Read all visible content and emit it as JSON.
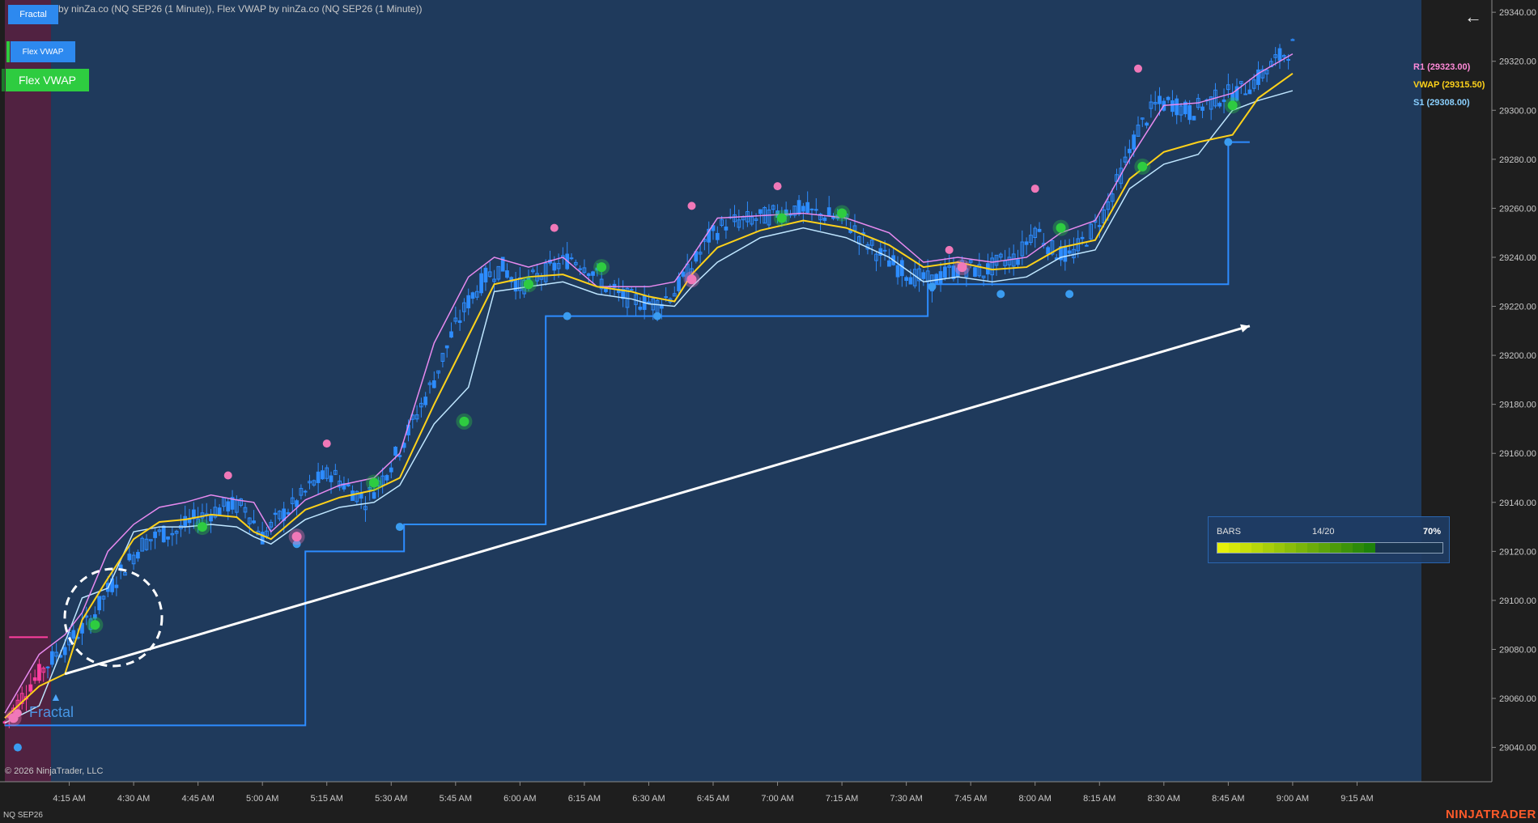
{
  "window": {
    "title": "Fractal Pro by ninZa.co (NQ SEP26 (1 Minute)), Flex VWAP by ninZa.co (NQ SEP26 (1 Minute))",
    "instrument": "NQ SEP26",
    "copyright": "© 2026 NinjaTrader, LLC",
    "brand": "NINJATRADER"
  },
  "buttons": {
    "fractal": "Fractal",
    "flex_vwap_small": "Flex VWAP",
    "flex_vwap_large": "Flex VWAP",
    "back_icon": "arrow-left-icon"
  },
  "watermark": "Fractal",
  "right_labels": {
    "r": "R1 (29323.00)",
    "vwap": "VWAP (29315.50)",
    "s": "S1 (29308.00)"
  },
  "progress_panel": {
    "title": "BARS",
    "count": "14/20",
    "percent": "70%",
    "fraction": 0.7
  },
  "colors": {
    "chart_bg": "#1f3a5c",
    "session_shade": "#5a1e3c",
    "candle": "#2d8cff",
    "upper_band": "#e88af0",
    "vwap": "#ffd21a",
    "lower_band": "#bfe6ff",
    "step_line": "#2d8cff",
    "trend_arrow": "#ffffff",
    "fractal_high": "#f078b8",
    "fractal_low": "#3a9cf0",
    "signal_green": "#2ecc40",
    "signal_pink": "#f078b8"
  },
  "chart_data": {
    "type": "line",
    "y_axis_ticks": [
      29040,
      29060,
      29080,
      29100,
      29120,
      29140,
      29160,
      29180,
      29200,
      29220,
      29240,
      29260,
      29280,
      29300,
      29320,
      29340
    ],
    "y_tick_labels": [
      "29040.00",
      "29060.00",
      "29080.00",
      "29100.00",
      "29120.00",
      "29140.00",
      "29160.00",
      "29180.00",
      "29200.00",
      "29220.00",
      "29240.00",
      "29260.00",
      "29280.00",
      "29300.00",
      "29320.00",
      "29340.00"
    ],
    "ylim": [
      29026,
      29345
    ],
    "x_axis_labels": [
      "4:15 AM",
      "4:30 AM",
      "4:45 AM",
      "5:00 AM",
      "5:15 AM",
      "5:30 AM",
      "5:45 AM",
      "6:00 AM",
      "6:15 AM",
      "6:30 AM",
      "6:45 AM",
      "7:00 AM",
      "7:15 AM",
      "7:30 AM",
      "7:45 AM",
      "8:00 AM",
      "8:15 AM",
      "8:30 AM",
      "8:45 AM",
      "9:00 AM",
      "9:15 AM"
    ],
    "x_axis_minutes": [
      15,
      30,
      45,
      60,
      75,
      90,
      105,
      120,
      135,
      150,
      165,
      180,
      195,
      210,
      225,
      240,
      255,
      270,
      285,
      300,
      315
    ],
    "xlim": [
      0,
      330
    ],
    "price_path": [
      [
        0,
        29050
      ],
      [
        6,
        29066
      ],
      [
        12,
        29078
      ],
      [
        16,
        29085
      ],
      [
        20,
        29092
      ],
      [
        24,
        29104
      ],
      [
        28,
        29114
      ],
      [
        32,
        29123
      ],
      [
        36,
        29127
      ],
      [
        40,
        29128
      ],
      [
        44,
        29133
      ],
      [
        48,
        29136
      ],
      [
        52,
        29139
      ],
      [
        56,
        29138
      ],
      [
        60,
        29126
      ],
      [
        64,
        29134
      ],
      [
        68,
        29140
      ],
      [
        72,
        29148
      ],
      [
        76,
        29152
      ],
      [
        80,
        29146
      ],
      [
        84,
        29141
      ],
      [
        88,
        29150
      ],
      [
        92,
        29162
      ],
      [
        96,
        29176
      ],
      [
        100,
        29190
      ],
      [
        104,
        29208
      ],
      [
        108,
        29222
      ],
      [
        112,
        29232
      ],
      [
        116,
        29236
      ],
      [
        120,
        29228
      ],
      [
        124,
        29232
      ],
      [
        128,
        29236
      ],
      [
        132,
        29240
      ],
      [
        136,
        29236
      ],
      [
        140,
        29228
      ],
      [
        144,
        29224
      ],
      [
        148,
        29222
      ],
      [
        152,
        29221
      ],
      [
        156,
        29226
      ],
      [
        160,
        29236
      ],
      [
        164,
        29248
      ],
      [
        168,
        29254
      ],
      [
        172,
        29255
      ],
      [
        176,
        29256
      ],
      [
        180,
        29258
      ],
      [
        184,
        29260
      ],
      [
        188,
        29258
      ],
      [
        192,
        29257
      ],
      [
        196,
        29255
      ],
      [
        200,
        29247
      ],
      [
        204,
        29241
      ],
      [
        208,
        29236
      ],
      [
        212,
        29232
      ],
      [
        216,
        29230
      ],
      [
        220,
        29234
      ],
      [
        224,
        29236
      ],
      [
        228,
        29234
      ],
      [
        232,
        29238
      ],
      [
        236,
        29240
      ],
      [
        240,
        29252
      ],
      [
        244,
        29243
      ],
      [
        248,
        29240
      ],
      [
        252,
        29248
      ],
      [
        256,
        29258
      ],
      [
        260,
        29274
      ],
      [
        264,
        29292
      ],
      [
        268,
        29302
      ],
      [
        272,
        29303
      ],
      [
        276,
        29299
      ],
      [
        280,
        29303
      ],
      [
        284,
        29306
      ],
      [
        288,
        29308
      ],
      [
        292,
        29313
      ],
      [
        296,
        29320
      ],
      [
        300,
        29326
      ]
    ],
    "upper_band": [
      [
        0,
        29054
      ],
      [
        8,
        29078
      ],
      [
        14,
        29086
      ],
      [
        18,
        29095
      ],
      [
        24,
        29120
      ],
      [
        30,
        29131
      ],
      [
        36,
        29138
      ],
      [
        42,
        29140
      ],
      [
        48,
        29143
      ],
      [
        54,
        29141
      ],
      [
        58,
        29140
      ],
      [
        62,
        29128
      ],
      [
        70,
        29141
      ],
      [
        78,
        29147
      ],
      [
        86,
        29150
      ],
      [
        92,
        29160
      ],
      [
        100,
        29205
      ],
      [
        108,
        29232
      ],
      [
        114,
        29240
      ],
      [
        122,
        29236
      ],
      [
        130,
        29240
      ],
      [
        138,
        29228
      ],
      [
        146,
        29228
      ],
      [
        150,
        29228
      ],
      [
        156,
        29230
      ],
      [
        160,
        29240
      ],
      [
        166,
        29256
      ],
      [
        176,
        29257
      ],
      [
        186,
        29258
      ],
      [
        196,
        29256
      ],
      [
        206,
        29250
      ],
      [
        214,
        29238
      ],
      [
        222,
        29240
      ],
      [
        230,
        29238
      ],
      [
        238,
        29240
      ],
      [
        246,
        29250
      ],
      [
        254,
        29255
      ],
      [
        262,
        29280
      ],
      [
        270,
        29302
      ],
      [
        278,
        29303
      ],
      [
        286,
        29307
      ],
      [
        292,
        29315
      ],
      [
        300,
        29323
      ]
    ],
    "vwap_line": [
      [
        0,
        29052
      ],
      [
        8,
        29065
      ],
      [
        14,
        29070
      ],
      [
        18,
        29092
      ],
      [
        24,
        29109
      ],
      [
        30,
        29125
      ],
      [
        36,
        29132
      ],
      [
        42,
        29133
      ],
      [
        48,
        29135
      ],
      [
        54,
        29134
      ],
      [
        58,
        29128
      ],
      [
        62,
        29125
      ],
      [
        70,
        29137
      ],
      [
        78,
        29142
      ],
      [
        86,
        29145
      ],
      [
        92,
        29150
      ],
      [
        100,
        29180
      ],
      [
        108,
        29208
      ],
      [
        114,
        29229
      ],
      [
        122,
        29232
      ],
      [
        130,
        29233
      ],
      [
        138,
        29228
      ],
      [
        146,
        29226
      ],
      [
        150,
        29224
      ],
      [
        156,
        29222
      ],
      [
        160,
        29233
      ],
      [
        166,
        29244
      ],
      [
        176,
        29251
      ],
      [
        186,
        29255
      ],
      [
        196,
        29252
      ],
      [
        206,
        29245
      ],
      [
        214,
        29236
      ],
      [
        222,
        29238
      ],
      [
        230,
        29235
      ],
      [
        238,
        29236
      ],
      [
        246,
        29244
      ],
      [
        254,
        29247
      ],
      [
        262,
        29272
      ],
      [
        270,
        29283
      ],
      [
        278,
        29287
      ],
      [
        286,
        29290
      ],
      [
        292,
        29305
      ],
      [
        300,
        29315
      ]
    ],
    "lower_band": [
      [
        0,
        29050
      ],
      [
        8,
        29057
      ],
      [
        14,
        29083
      ],
      [
        18,
        29101
      ],
      [
        24,
        29105
      ],
      [
        30,
        29128
      ],
      [
        36,
        29130
      ],
      [
        42,
        29130
      ],
      [
        48,
        29131
      ],
      [
        54,
        29130
      ],
      [
        58,
        29126
      ],
      [
        62,
        29123
      ],
      [
        70,
        29133
      ],
      [
        78,
        29138
      ],
      [
        86,
        29140
      ],
      [
        92,
        29147
      ],
      [
        100,
        29172
      ],
      [
        108,
        29187
      ],
      [
        114,
        29226
      ],
      [
        122,
        29228
      ],
      [
        130,
        29230
      ],
      [
        138,
        29225
      ],
      [
        146,
        29223
      ],
      [
        150,
        29221
      ],
      [
        156,
        29220
      ],
      [
        160,
        29228
      ],
      [
        166,
        29238
      ],
      [
        176,
        29248
      ],
      [
        186,
        29252
      ],
      [
        196,
        29248
      ],
      [
        206,
        29240
      ],
      [
        214,
        29230
      ],
      [
        222,
        29232
      ],
      [
        230,
        29230
      ],
      [
        238,
        29232
      ],
      [
        246,
        29240
      ],
      [
        254,
        29243
      ],
      [
        262,
        29268
      ],
      [
        270,
        29278
      ],
      [
        278,
        29282
      ],
      [
        286,
        29300
      ],
      [
        292,
        29304
      ],
      [
        300,
        29308
      ]
    ],
    "step_line": [
      [
        0,
        29049
      ],
      [
        70,
        29049
      ],
      [
        70,
        29120
      ],
      [
        93,
        29120
      ],
      [
        93,
        29131
      ],
      [
        126,
        29131
      ],
      [
        126,
        29216
      ],
      [
        215,
        29216
      ],
      [
        215,
        29229
      ],
      [
        285,
        29229
      ],
      [
        285,
        29287
      ],
      [
        290,
        29287
      ]
    ],
    "trend_arrow": {
      "from": [
        14,
        29070
      ],
      "to": [
        290,
        29212
      ]
    },
    "fractal_highs": [
      [
        3,
        29054
      ],
      [
        52,
        29151
      ],
      [
        75,
        29164
      ],
      [
        128,
        29252
      ],
      [
        160,
        29261
      ],
      [
        180,
        29269
      ],
      [
        220,
        29243
      ],
      [
        240,
        29268
      ],
      [
        264,
        29317
      ]
    ],
    "fractal_lows": [
      [
        3,
        29040
      ],
      [
        68,
        29123
      ],
      [
        92,
        29130
      ],
      [
        131,
        29216
      ],
      [
        152,
        29216
      ],
      [
        216,
        29228
      ],
      [
        232,
        29225
      ],
      [
        248,
        29225
      ],
      [
        285,
        29287
      ]
    ],
    "signals_green": [
      [
        21,
        29090
      ],
      [
        46,
        29130
      ],
      [
        86,
        29148
      ],
      [
        107,
        29173
      ],
      [
        122,
        29229
      ],
      [
        139,
        29236
      ],
      [
        181,
        29256
      ],
      [
        195,
        29258
      ],
      [
        246,
        29252
      ],
      [
        265,
        29277
      ],
      [
        286,
        29302
      ]
    ],
    "signals_pink": [
      [
        2,
        29052
      ],
      [
        68,
        29126
      ],
      [
        160,
        29231
      ],
      [
        223,
        29236
      ]
    ]
  }
}
